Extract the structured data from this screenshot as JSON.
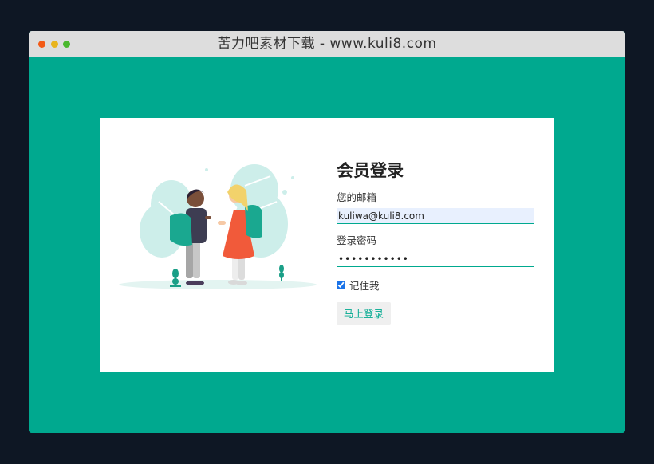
{
  "window": {
    "title": "苦力吧素材下载 - www.kuli8.com"
  },
  "login": {
    "heading": "会员登录",
    "email_label": "您的邮箱",
    "email_value": "kuliwa@kuli8.com",
    "password_label": "登录密码",
    "password_value": "kuli8passwd",
    "remember_label": "记住我",
    "remember_checked": true,
    "submit_label": "马上登录"
  },
  "colors": {
    "background": "#00a98f",
    "outer": "#0e1724",
    "titlebar": "#dddddd",
    "card": "#ffffff",
    "accent": "#00a98f"
  },
  "icons": {
    "window_controls": [
      "close-dot",
      "minimize-dot",
      "maximize-dot"
    ],
    "illustration": "students-with-backpacks-illustration"
  }
}
